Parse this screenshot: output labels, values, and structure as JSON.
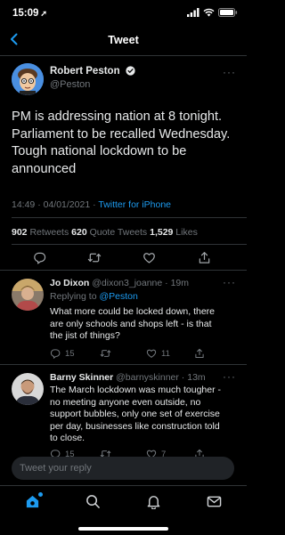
{
  "status_bar": {
    "time": "15:09",
    "location_arrow": "➚"
  },
  "nav": {
    "title": "Tweet",
    "back_icon": "chevron-left-icon"
  },
  "main_tweet": {
    "author_name": "Robert Peston",
    "author_handle": "@Peston",
    "text_lines": [
      "PM is addressing nation at 8 tonight.",
      "Parliament to be recalled Wednesday.",
      "Tough national lockdown to be",
      "announced"
    ],
    "timestamp": "14:49 · 04/01/2021 · ",
    "source": "Twitter for iPhone",
    "retweets_count": "902",
    "retweets_label": " Retweets  ",
    "quote_count": "620",
    "quote_label": " Quote Tweets  ",
    "likes_count": "1,529",
    "likes_label": " Likes"
  },
  "replies": [
    {
      "name": "Jo Dixon",
      "handle": " @dixon3_joanne · 19m",
      "replying_to_label": "Replying to ",
      "replying_to_handle": "@Peston",
      "text_lines": [
        "What more could be locked down, there",
        "are only schools and shops left - is that",
        "the jist of things?"
      ],
      "reply_count": "15",
      "retweet_count": "",
      "like_count": "11"
    },
    {
      "name": "Barny Skinner",
      "handle": " @barnyskinner · 13m",
      "text_lines": [
        "The March lockdown was much tougher -",
        "no meeting anyone even outside, no",
        "support bubbles, only one set of exercise",
        "per day, businesses like construction told",
        "to close."
      ],
      "reply_count": "15",
      "like_count": "7"
    }
  ],
  "compose": {
    "placeholder": "Tweet your reply"
  },
  "colors": {
    "accent": "#1d9bf0",
    "background": "#000000",
    "muted": "#71767b",
    "divider": "#2f3336"
  }
}
